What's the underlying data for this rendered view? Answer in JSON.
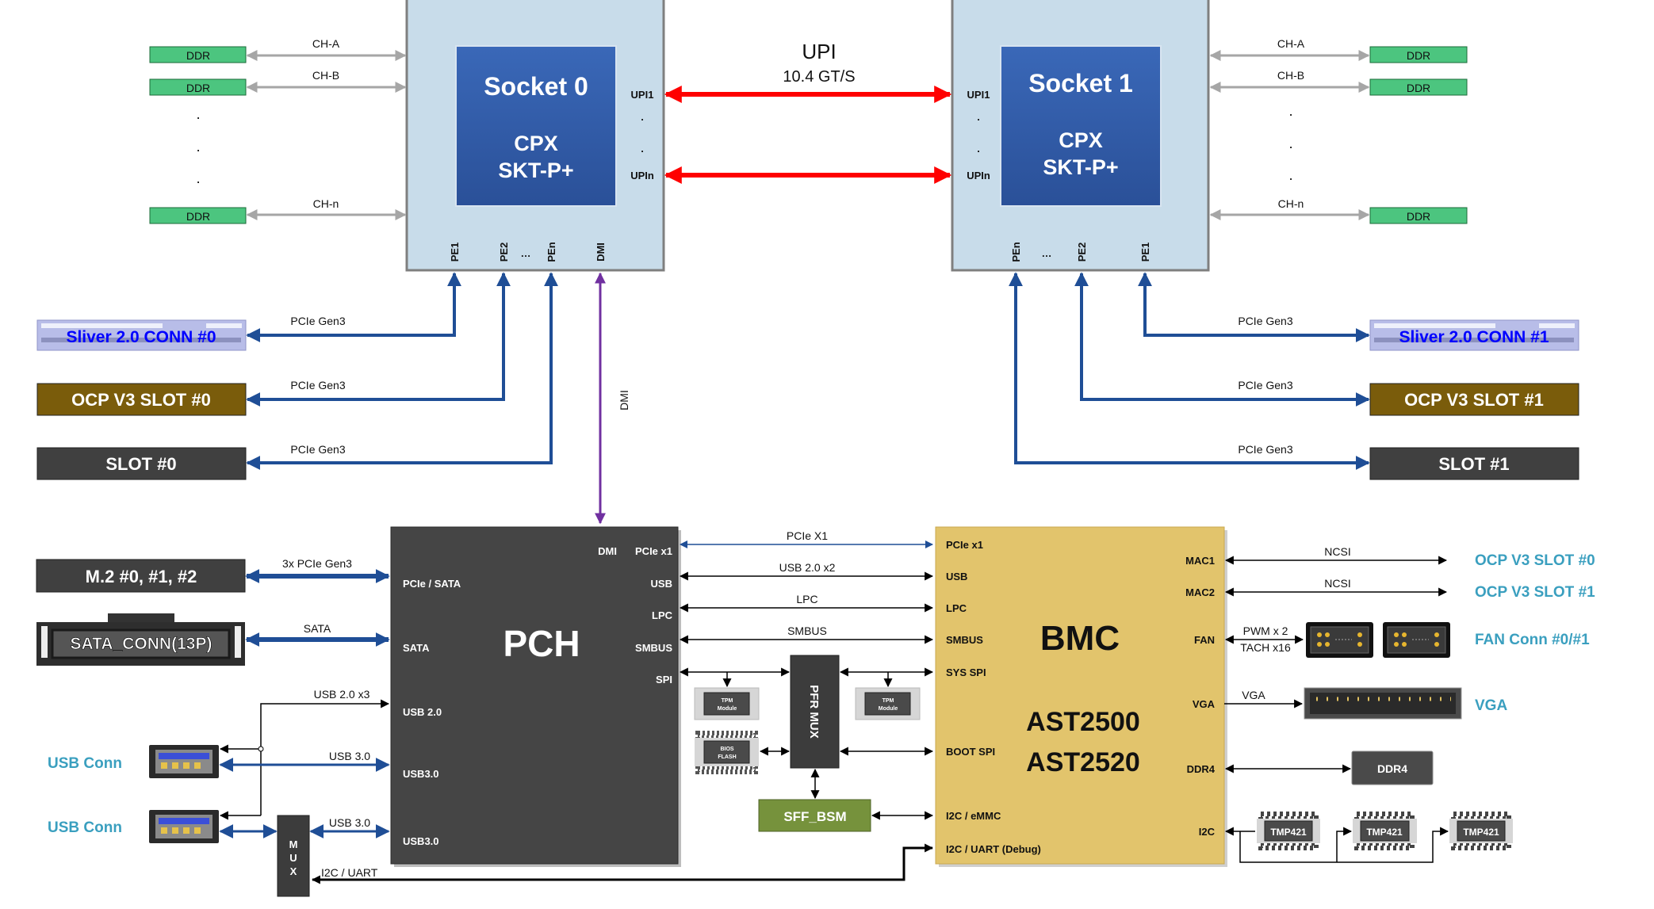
{
  "upi": {
    "label": "UPI",
    "speed": "10.4 GT/S"
  },
  "ddr": {
    "box_label": "DDR",
    "channels": [
      "CH-A",
      "CH-B",
      "CH-n"
    ],
    "dot": "."
  },
  "sockets": [
    {
      "title": "Socket 0",
      "line1": "CPX",
      "line2": "SKT-P+",
      "upi_first": "UPI1",
      "upi_last": "UPIn",
      "dot": ".",
      "pe": [
        "PE1",
        "PE2",
        "PEn",
        "DMI"
      ],
      "ellipsis": "…"
    },
    {
      "title": "Socket 1",
      "line1": "CPX",
      "line2": "SKT-P+",
      "upi_first": "UPI1",
      "upi_last": "UPIn",
      "dot": ".",
      "pe": [
        "PE1",
        "PE2",
        "PEn"
      ],
      "ellipsis": "…"
    }
  ],
  "left_slots": [
    {
      "label": "Sliver 2.0 CONN #0",
      "link": "PCIe Gen3"
    },
    {
      "label": "OCP V3 SLOT #0",
      "link": "PCIe Gen3"
    },
    {
      "label": "SLOT #0",
      "link": "PCIe Gen3"
    }
  ],
  "right_slots": [
    {
      "label": "Sliver 2.0 CONN #1",
      "link": "PCIe Gen3"
    },
    {
      "label": "OCP V3 SLOT #1",
      "link": "PCIe Gen3"
    },
    {
      "label": "SLOT #1",
      "link": "PCIe Gen3"
    }
  ],
  "dmi_link": "DMI",
  "pch": {
    "title": "PCH",
    "left_ports": [
      "PCIe / SATA",
      "SATA",
      "USB 2.0",
      "USB3.0",
      "USB3.0"
    ],
    "right_ports": [
      "DMI",
      "PCIe x1",
      "USB",
      "LPC",
      "SMBUS",
      "SPI"
    ]
  },
  "storage": {
    "m2": {
      "label": "M.2 #0, #1, #2",
      "link": "3x PCIe Gen3"
    },
    "sata": {
      "label": "SATA_CONN(13P)",
      "link": "SATA"
    }
  },
  "usb": {
    "conn_label": "USB Conn",
    "usb2_link": "USB 2.0 x3",
    "usb3_link": "USB 3.0",
    "mux_letters": [
      "M",
      "U",
      "X"
    ],
    "i2c_uart_link": "I2C / UART"
  },
  "pch_bmc_links": [
    "PCIe X1",
    "USB 2.0 x2",
    "LPC",
    "SMBUS"
  ],
  "spi": {
    "tpm": [
      "TPM",
      "Module"
    ],
    "bios": [
      "BIOS",
      "FLASH"
    ],
    "pfr_mux": "PFR MUX",
    "sff_bsm": "SFF_BSM"
  },
  "bmc": {
    "title": "BMC",
    "models": [
      "AST2500",
      "AST2520"
    ],
    "left_ports": [
      "PCIe x1",
      "USB",
      "LPC",
      "SMBUS",
      "SYS SPI",
      "BOOT SPI",
      "I2C / eMMC",
      "I2C / UART (Debug)"
    ],
    "right_ports": [
      "MAC1",
      "MAC2",
      "FAN",
      "VGA",
      "DDR4",
      "I2C"
    ]
  },
  "bmc_right": {
    "ncsi": "NCSI",
    "ocp_targets": [
      "OCP V3 SLOT #0",
      "OCP V3 SLOT #1"
    ],
    "fan_links": [
      "PWM x 2",
      "TACH x16"
    ],
    "fan_label": "FAN Conn #0/#1",
    "vga_link": "VGA",
    "vga_label": "VGA",
    "ddr4": "DDR4",
    "tmp": "TMP421"
  },
  "colors": {
    "socket_outer": "#c8dcea",
    "socket_inner": "#2f5ba8",
    "ddr": "#4cc57f",
    "ocp": "#7a5c0b",
    "slot": "#404040",
    "pch": "#454545",
    "bmc": "#e2c46c",
    "sff_bsm": "#76923c",
    "pcie": "#1f4e96",
    "upi": "#ff0000",
    "dmi": "#7030a0",
    "teal": "#3a9fbf"
  }
}
